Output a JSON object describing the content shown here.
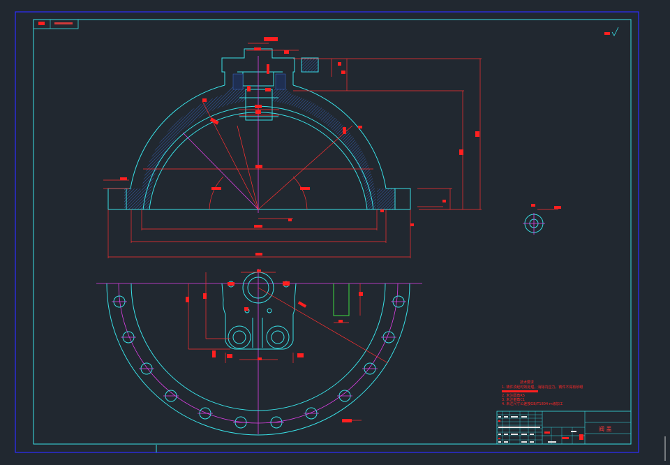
{
  "title_block": {
    "part_name": "阀  盖",
    "roughness_symbol": "Ra"
  },
  "views": {
    "section_a_label": "A向"
  },
  "technical_requirements": {
    "heading": "技术要求",
    "items": [
      "1. 铸件须经时效处理，消除内应力。铸件不得有砂眼",
      "2. 未注圆角R5",
      "3. 未注倒角C1",
      "4. 未注尺寸公差按GB/T1804-m级加工"
    ]
  },
  "colors": {
    "background": "#212830",
    "frame": "#2d2dff",
    "outline": "#39e0e6",
    "centerline": "#e040e8",
    "dimension": "#ff3030",
    "hatch": "#3a6ad0"
  }
}
